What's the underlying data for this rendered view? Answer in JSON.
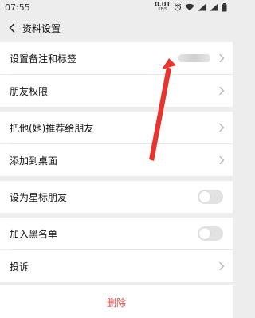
{
  "status_bar": {
    "time": "07:55",
    "net_speed_value": "0.01",
    "net_speed_unit": "KB/S"
  },
  "header": {
    "title": "资料设置"
  },
  "rows": {
    "remark": {
      "label": "设置备注和标签"
    },
    "permissions": {
      "label": "朋友权限"
    },
    "recommend": {
      "label": "把他(她)推荐给朋友"
    },
    "desktop": {
      "label": "添加到桌面"
    },
    "star": {
      "label": "设为星标朋友",
      "toggle_on": false
    },
    "blacklist": {
      "label": "加入黑名单",
      "toggle_on": false
    },
    "report": {
      "label": "投诉"
    }
  },
  "delete": {
    "label": "删除"
  },
  "colors": {
    "delete_red": "#e05252",
    "annotation_arrow": "#e8342f",
    "background": "#ededed"
  },
  "icons": {
    "back": "chevron-left-icon",
    "row_chevron": "chevron-right-icon",
    "alarm": "alarm-icon",
    "wifi": "wifi-icon",
    "signal": "signal-icon",
    "battery": "battery-icon"
  }
}
